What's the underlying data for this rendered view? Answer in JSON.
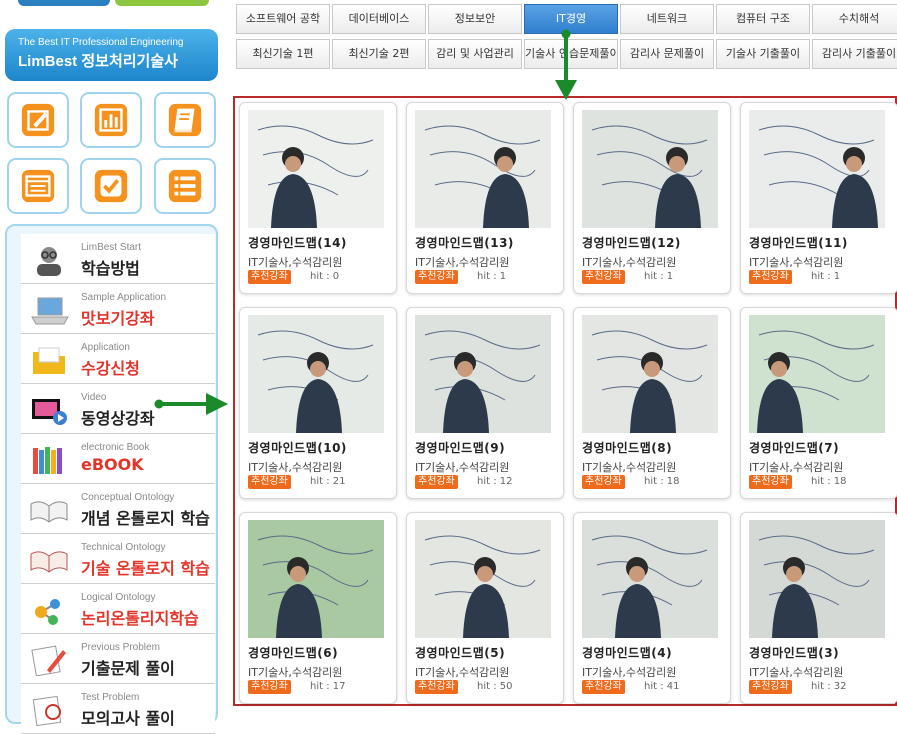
{
  "sidebar": {
    "banner": {
      "line1": "The Best IT Professional Engineering",
      "line2": "LimBest 정보처리기술사"
    },
    "quick_buttons": [
      "edit-icon",
      "chart-icon",
      "book-icon",
      "form-icon",
      "check-icon",
      "list-icon"
    ],
    "menu": [
      {
        "sub": "LimBest Start",
        "main": "학습방법",
        "red": false,
        "icon": "avatar-icon"
      },
      {
        "sub": "Sample Application",
        "main": "맛보기강좌",
        "red": true,
        "icon": "laptop-icon"
      },
      {
        "sub": "Application",
        "main": "수강신청",
        "red": true,
        "icon": "folder-icon"
      },
      {
        "sub": "Video",
        "main": "동영상강좌",
        "red": false,
        "icon": "video-icon"
      },
      {
        "sub": "electronic Book",
        "main": "eBOOK",
        "red": true,
        "icon": "books-icon"
      },
      {
        "sub": "Conceptual Ontology",
        "main": "개념 온톨로지 학습",
        "red": false,
        "icon": "open-book-icon"
      },
      {
        "sub": "Technical Ontology",
        "main": "기술 온톨로지 학습",
        "red": true,
        "icon": "open-book-red-icon"
      },
      {
        "sub": "Logical Ontology",
        "main": "논리온톨리지학습",
        "red": true,
        "icon": "molecule-icon"
      },
      {
        "sub": "Previous Problem",
        "main": "기출문제 풀이",
        "red": false,
        "icon": "pencil-paper-icon"
      },
      {
        "sub": "Test Problem",
        "main": "모의고사 풀이",
        "red": false,
        "icon": "test-paper-icon"
      }
    ]
  },
  "tabs_row1": [
    {
      "label": "소프트웨어 공학",
      "active": false
    },
    {
      "label": "데이터베이스",
      "active": false
    },
    {
      "label": "정보보안",
      "active": false
    },
    {
      "label": "IT경영",
      "active": true
    },
    {
      "label": "네트워크",
      "active": false
    },
    {
      "label": "컴퓨터 구조",
      "active": false
    },
    {
      "label": "수치해석",
      "active": false
    }
  ],
  "tabs_row2": [
    {
      "label": "최신기술 1편",
      "active": false
    },
    {
      "label": "최신기술 2편",
      "active": false
    },
    {
      "label": "감리 및 사업관리",
      "active": false
    },
    {
      "label": "기술사 연습문제풀이",
      "active": false
    },
    {
      "label": "감리사 문제풀이",
      "active": false
    },
    {
      "label": "기술사 기출풀이",
      "active": false
    },
    {
      "label": "감리사 기출풀이",
      "active": false
    }
  ],
  "videos": [
    {
      "title": "경영마인드맵(14)",
      "meta": "IT기술사,수석감리원",
      "badge": "추천강좌",
      "hit": "hit : 0"
    },
    {
      "title": "경영마인드맵(13)",
      "meta": "IT기술사,수석감리원",
      "badge": "추천강좌",
      "hit": "hit : 1"
    },
    {
      "title": "경영마인드맵(12)",
      "meta": "IT기술사,수석감리원",
      "badge": "추천강좌",
      "hit": "hit : 1"
    },
    {
      "title": "경영마인드맵(11)",
      "meta": "IT기술사,수석감리원",
      "badge": "추천강좌",
      "hit": "hit : 1"
    },
    {
      "title": "경영마인드맵(10)",
      "meta": "IT기술사,수석감리원",
      "badge": "추천강좌",
      "hit": "hit : 21"
    },
    {
      "title": "경영마인드맵(9)",
      "meta": "IT기술사,수석감리원",
      "badge": "추천강좌",
      "hit": "hit : 12"
    },
    {
      "title": "경영마인드맵(8)",
      "meta": "IT기술사,수석감리원",
      "badge": "추천강좌",
      "hit": "hit : 18"
    },
    {
      "title": "경영마인드맵(7)",
      "meta": "IT기술사,수석감리원",
      "badge": "추천강좌",
      "hit": "hit : 18"
    },
    {
      "title": "경영마인드맵(6)",
      "meta": "IT기술사,수석감리원",
      "badge": "추천강좌",
      "hit": "hit : 17"
    },
    {
      "title": "경영마인드맵(5)",
      "meta": "IT기술사,수석감리원",
      "badge": "추천강좌",
      "hit": "hit : 50"
    },
    {
      "title": "경영마인드맵(4)",
      "meta": "IT기술사,수석감리원",
      "badge": "추천강좌",
      "hit": "hit : 41"
    },
    {
      "title": "경영마인드맵(3)",
      "meta": "IT기술사,수석감리원",
      "badge": "추천강좌",
      "hit": "hit : 32"
    }
  ],
  "colors": {
    "accent_blue": "#2f7fcf",
    "highlight_red": "#b92a2a",
    "arrow_green": "#1a8a2a",
    "badge_orange": "#f06a1c"
  }
}
